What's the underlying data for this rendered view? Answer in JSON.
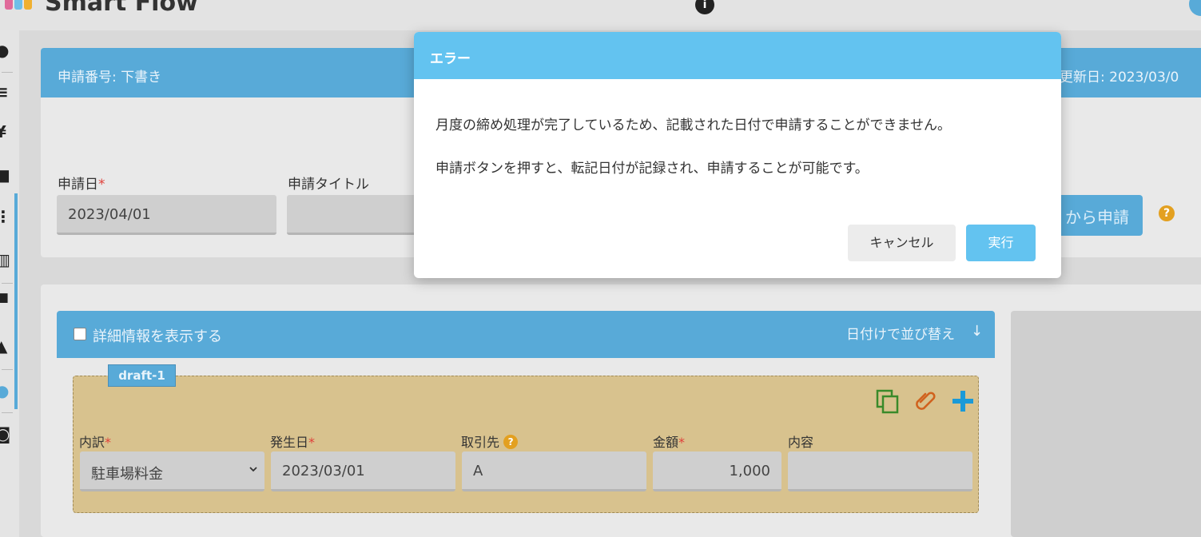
{
  "app": {
    "brand": "Smart Flow"
  },
  "colors": {
    "primary": "#58aad8",
    "modal_header": "#63c3f0",
    "required": "#e0403a",
    "draft_bg": "#d8c28e",
    "help": "#e3a020"
  },
  "header_panel": {
    "app_number": "申請番号: 下書き",
    "updated": "更新日: 2023/03/0",
    "fields": {
      "apply_date": {
        "label": "申請日",
        "required_mark": "*",
        "value": "2023/04/01"
      },
      "apply_title": {
        "label": "申請タイトル",
        "value": ""
      }
    },
    "apply_button": "から申請",
    "help_icon": "?"
  },
  "details": {
    "show_detail_label": "詳細情報を表示する",
    "sort_label": "日付けで並び替え",
    "sort_arrow": "↓",
    "draft": {
      "tag": "draft-1",
      "icons": [
        "copy-icon",
        "paperclip-icon",
        "plus-icon"
      ],
      "fields": {
        "breakdown": {
          "label": "内訳",
          "required_mark": "*",
          "value": "駐車場料金"
        },
        "occurred": {
          "label": "発生日",
          "required_mark": "*",
          "value": "2023/03/01"
        },
        "partner": {
          "label": "取引先",
          "value": "A"
        },
        "amount": {
          "label": "金額",
          "required_mark": "*",
          "value": "1,000"
        },
        "content": {
          "label": "内容",
          "value": ""
        }
      }
    }
  },
  "modal": {
    "title": "エラー",
    "message_1": "月度の締め処理が完了しているため、記載された日付で申請することができません。",
    "message_2": "申請ボタンを押すと、転記日付が記録され、申請することが可能です。",
    "cancel": "キャンセル",
    "execute": "実行"
  }
}
